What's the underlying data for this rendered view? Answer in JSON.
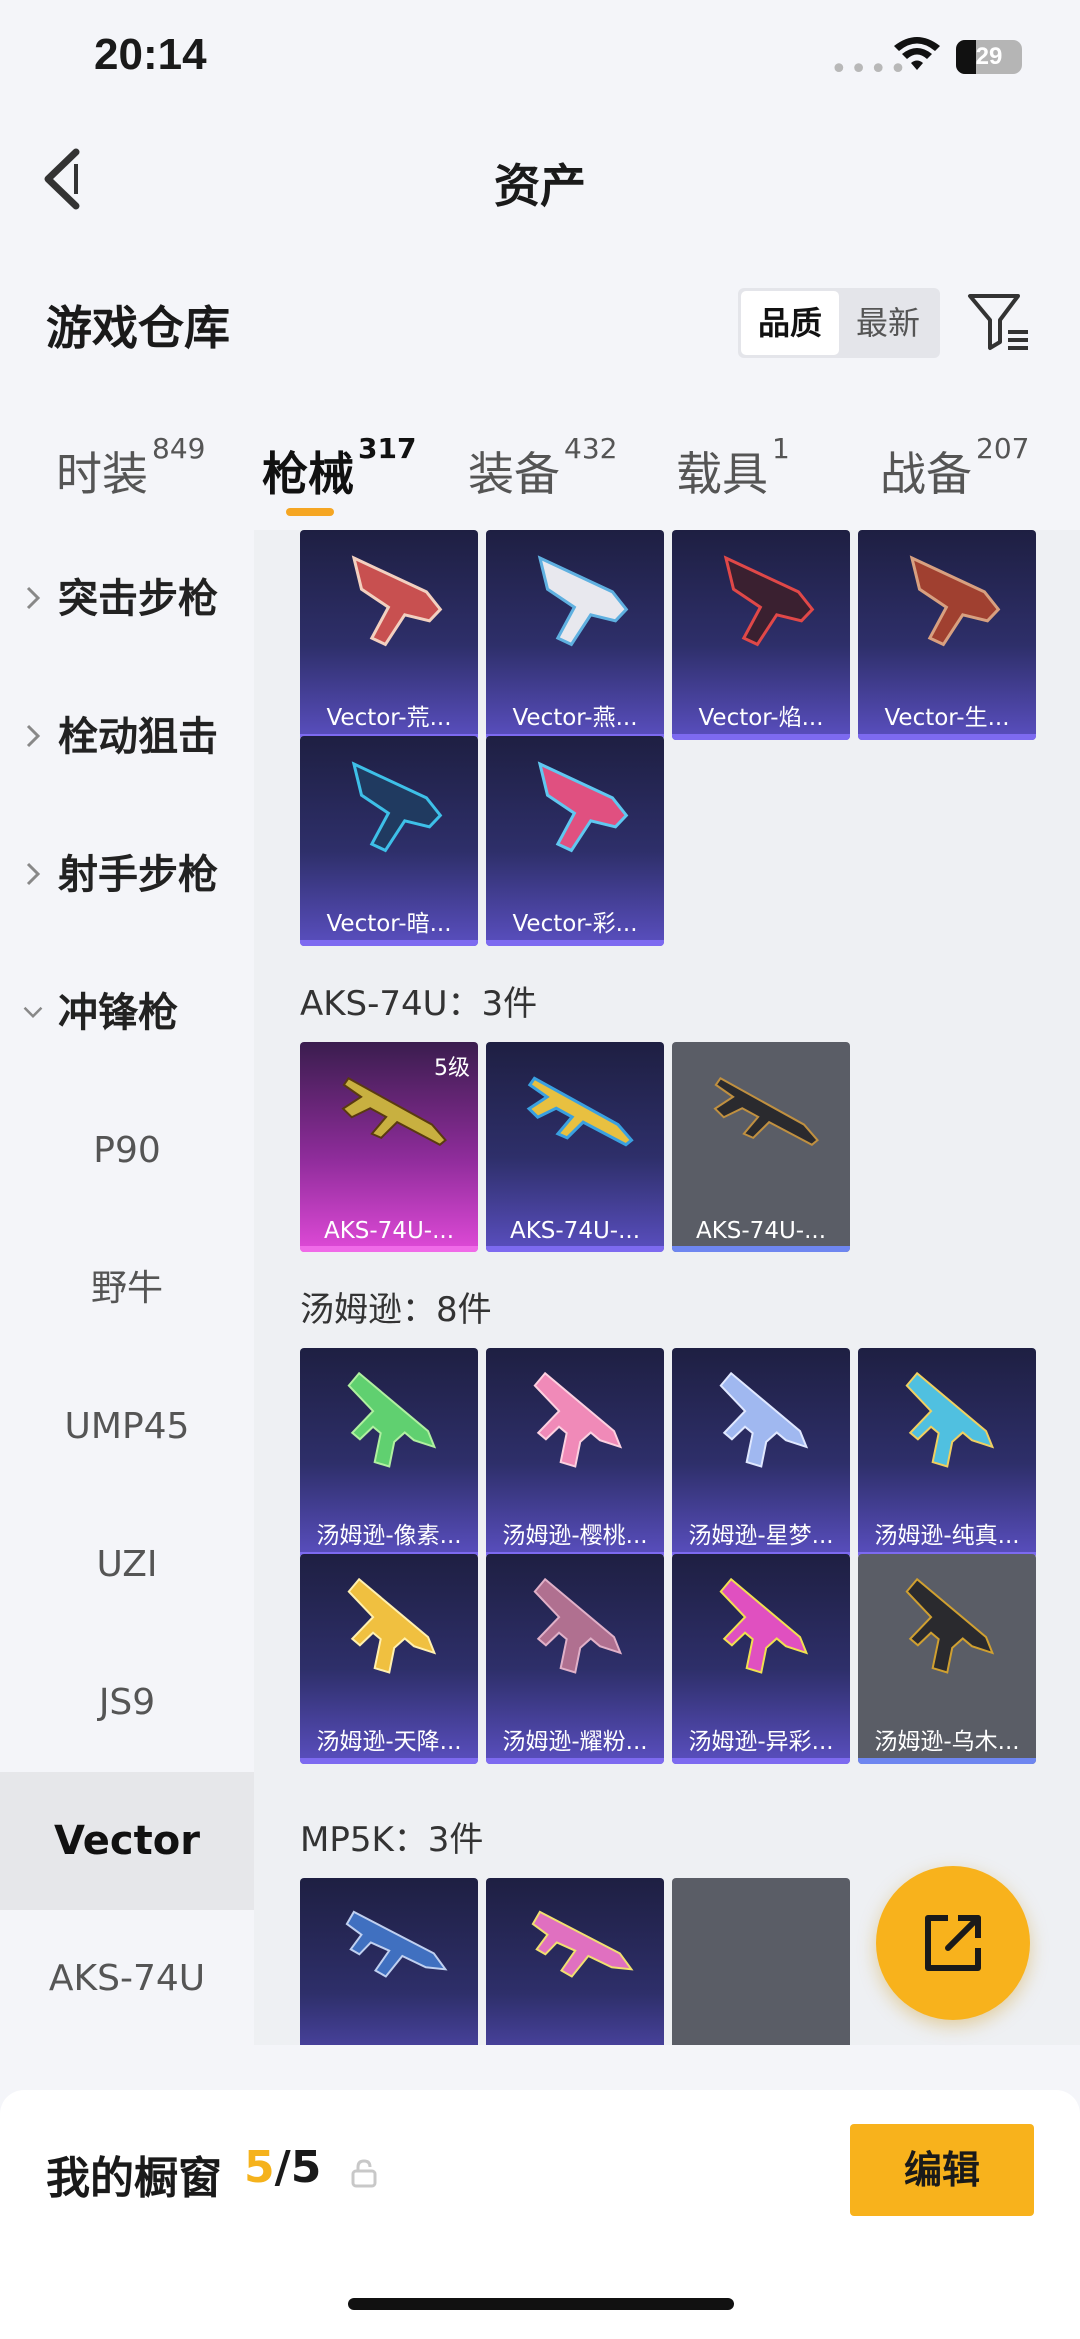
{
  "status": {
    "time": "20:14",
    "battery": "29"
  },
  "nav": {
    "title": "资产"
  },
  "warehouse": {
    "title": "游戏仓库",
    "sort_options": [
      "品质",
      "最新"
    ],
    "active_sort": "品质"
  },
  "tabs": [
    {
      "label": "时装",
      "count": "849"
    },
    {
      "label": "枪械",
      "count": "317",
      "active": true
    },
    {
      "label": "装备",
      "count": "432"
    },
    {
      "label": "载具",
      "count": "1"
    },
    {
      "label": "战备",
      "count": "207"
    }
  ],
  "sidebar": {
    "categories": [
      {
        "label": "突击步枪",
        "expanded": false
      },
      {
        "label": "栓动狙击",
        "expanded": false
      },
      {
        "label": "射手步枪",
        "expanded": false
      },
      {
        "label": "冲锋枪",
        "expanded": true
      }
    ],
    "subitems": [
      "P90",
      "野牛",
      "UMP45",
      "UZI",
      "JS9",
      "Vector",
      "AKS-74U"
    ],
    "selected": "Vector"
  },
  "sections": {
    "vector": {
      "items": [
        "Vector-荒...",
        "Vector-燕...",
        "Vector-焰...",
        "Vector-生...",
        "Vector-暗...",
        "Vector-彩..."
      ]
    },
    "aks": {
      "title": "AKS-74U：3件",
      "items": [
        {
          "name": "AKS-74U-...",
          "level": "5级"
        },
        {
          "name": "AKS-74U-..."
        },
        {
          "name": "AKS-74U-..."
        }
      ]
    },
    "thompson": {
      "title": "汤姆逊：8件",
      "items": [
        "汤姆逊-像素...",
        "汤姆逊-樱桃...",
        "汤姆逊-星梦...",
        "汤姆逊-纯真...",
        "汤姆逊-天降...",
        "汤姆逊-耀粉...",
        "汤姆逊-异彩...",
        "汤姆逊-乌木..."
      ]
    },
    "mp5k": {
      "title": "MP5K：3件"
    }
  },
  "showcase": {
    "label": "我的橱窗",
    "current": "5",
    "total": "/5",
    "edit_label": "编辑"
  },
  "colors": {
    "accent": "#f8b21c",
    "card_purple": "#2e2f6a",
    "card_pink": "#8e2c9a",
    "card_gray": "#5a5d66"
  }
}
